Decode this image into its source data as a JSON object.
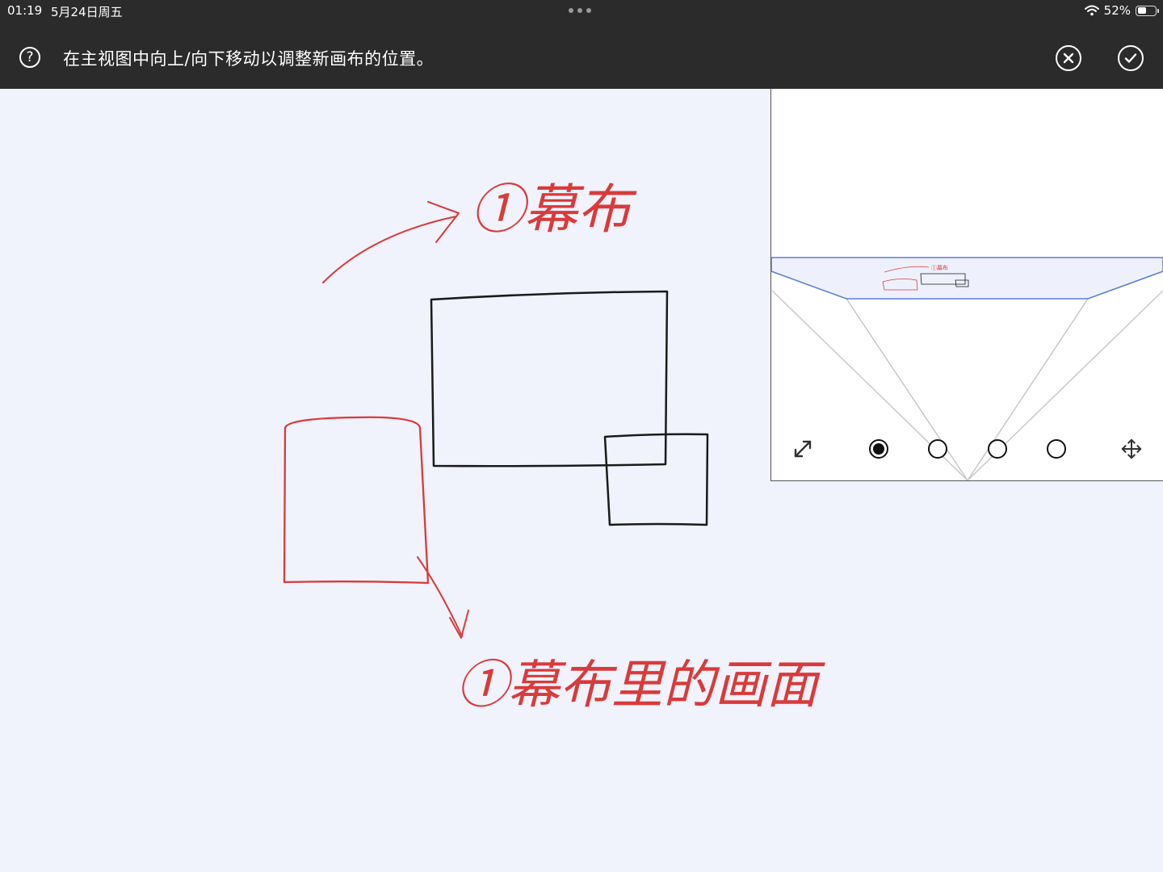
{
  "status_bar": {
    "time": "01:19",
    "date": "5月24日周五",
    "battery": "52%",
    "battery_level": 0.52
  },
  "toolbar": {
    "help_symbol": "?",
    "instruction": "在主视图中向上/向下移动以调整新画布的位置。",
    "cancel_icon": "close-circle-icon",
    "confirm_icon": "checkmark-circle-icon"
  },
  "canvas": {
    "annotation_top": "①幕布",
    "annotation_bottom": "①幕布里的画面",
    "ink_red": "#d93a3a",
    "ink_black": "#1a1a1a"
  },
  "preview": {
    "pages": [
      {
        "selected": true
      },
      {
        "selected": false
      },
      {
        "selected": false
      },
      {
        "selected": false
      }
    ],
    "expand_icon": "diagonal-expand-icon",
    "move_icon": "move-arrows-icon",
    "accent": "#5b7fd6"
  }
}
